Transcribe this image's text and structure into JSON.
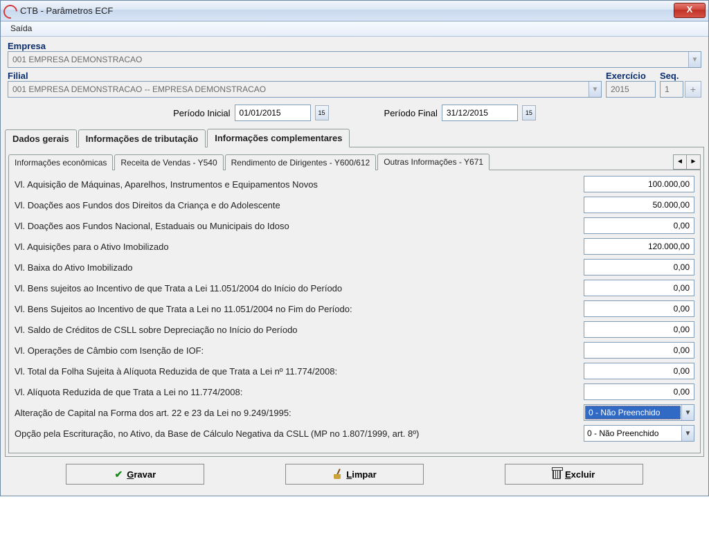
{
  "window": {
    "title": "CTB - Parâmetros ECF"
  },
  "menu": {
    "saida": "Saída"
  },
  "header": {
    "empresa_label": "Empresa",
    "empresa_value": "001 EMPRESA DEMONSTRACAO",
    "filial_label": "Filial",
    "filial_value": "001 EMPRESA DEMONSTRACAO -- EMPRESA DEMONSTRACAO",
    "exercicio_label": "Exercício",
    "exercicio_value": "2015",
    "seq_label": "Seq.",
    "seq_value": "1",
    "periodo_inicial_label": "Período Inicial",
    "periodo_inicial_value": "01/01/2015",
    "periodo_final_label": "Período Final",
    "periodo_final_value": "31/12/2015",
    "date_btn": "15"
  },
  "tabs": {
    "dados_gerais": "Dados gerais",
    "info_tributacao": "Informações de tributação",
    "info_complementares": "Informações complementares"
  },
  "subtabs": {
    "info_economicas": "Informações econômicas",
    "receita_vendas": "Receita de Vendas - Y540",
    "rendimento_dirigentes": "Rendimento de Dirigentes - Y600/612",
    "outras_info": "Outras Informações - Y671"
  },
  "fields": {
    "f1": {
      "label": "Vl. Aquisição de Máquinas, Aparelhos, Instrumentos e Equipamentos Novos",
      "value": "100.000,00"
    },
    "f2": {
      "label": "Vl. Doações aos Fundos dos Direitos da Criança e do Adolescente",
      "value": "50.000,00"
    },
    "f3": {
      "label": "Vl. Doações aos Fundos Nacional, Estaduais ou Municipais do Idoso",
      "value": "0,00"
    },
    "f4": {
      "label": "Vl. Aquisições para o Ativo Imobilizado",
      "value": "120.000,00"
    },
    "f5": {
      "label": "Vl. Baixa do Ativo Imobilizado",
      "value": "0,00"
    },
    "f6": {
      "label": "Vl. Bens sujeitos ao Incentivo de que Trata a Lei 11.051/2004 do Início do Período",
      "value": "0,00"
    },
    "f7": {
      "label": "Vl. Bens Sujeitos ao Incentivo de que Trata a Lei no 11.051/2004 no Fim do Período:",
      "value": "0,00"
    },
    "f8": {
      "label": "Vl. Saldo de Créditos de CSLL sobre Depreciação no Início do Período",
      "value": "0,00"
    },
    "f9": {
      "label": "Vl. Operações de Câmbio com Isenção de IOF:",
      "value": "0,00"
    },
    "f10": {
      "label": "Vl. Total da Folha Sujeita à Alíquota Reduzida de que Trata a Lei nº 11.774/2008:",
      "value": "0,00"
    },
    "f11": {
      "label": "Vl. Alíquota Reduzida de que Trata a Lei no 11.774/2008:",
      "value": "0,00"
    },
    "f12": {
      "label": "Alteração de Capital na Forma dos art. 22 e 23 da Lei no 9.249/1995:",
      "value": "0 - Não Preenchido"
    },
    "f13": {
      "label": "Opção pela Escrituração, no Ativo, da Base de Cálculo Negativa da CSLL (MP no 1.807/1999, art. 8º)",
      "value": "0 - Não Preenchido"
    }
  },
  "buttons": {
    "gravar": "Gravar",
    "limpar": "Limpar",
    "excluir": "Excluir"
  }
}
